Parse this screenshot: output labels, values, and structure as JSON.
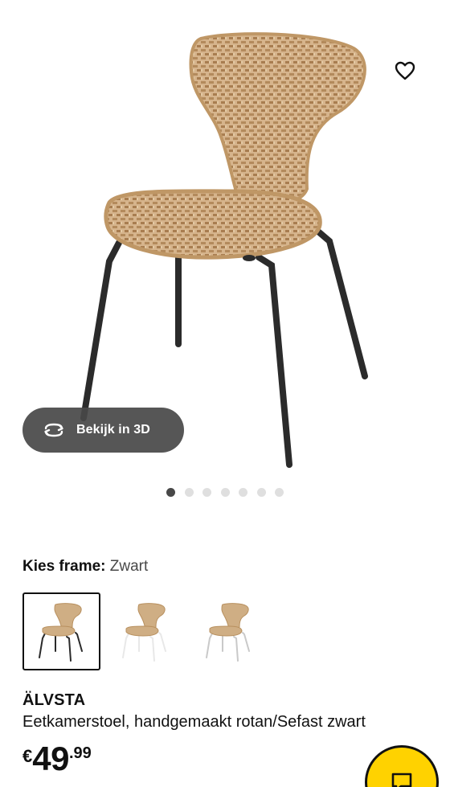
{
  "gallery": {
    "image_alt": "rattan dining chair",
    "view3d_label": "Bekijk in 3D",
    "dots_total": 7,
    "active_dot": 1
  },
  "frame": {
    "label": "Kies frame:",
    "value": "Zwart",
    "variants": [
      {
        "name": "Zwart",
        "selected": true,
        "leg_color": "#2a2a2a"
      },
      {
        "name": "Wit",
        "selected": false,
        "leg_color": "#e8e8e8"
      },
      {
        "name": "Chroom",
        "selected": false,
        "leg_color": "#c9c9c9"
      }
    ]
  },
  "product": {
    "name": "ÄLVSTA",
    "description": "Eetkamerstoel, handgemaakt rotan/Sefast zwart"
  },
  "price": {
    "currency": "€",
    "integer": "49",
    "decimal": ".99"
  },
  "colors": {
    "accent_yellow": "#ffd200",
    "pill_bg": "#484848",
    "rattan": "#c9a57a"
  },
  "icons": {
    "favorite": "heart-outline-icon",
    "rotate3d": "rotate-3d-icon",
    "fab": "chat-icon"
  }
}
